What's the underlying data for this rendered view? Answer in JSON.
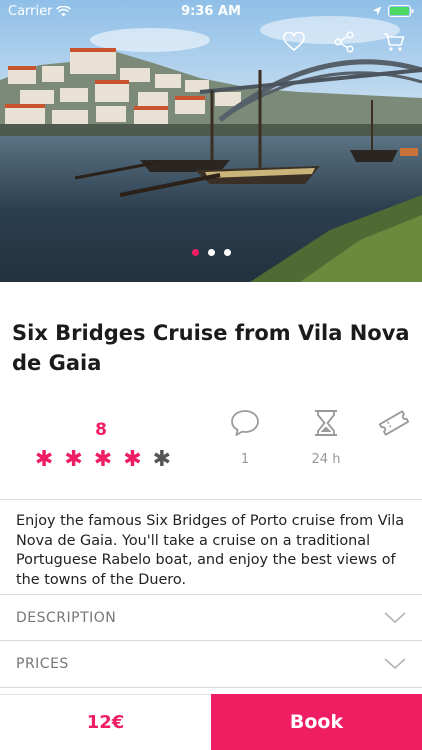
{
  "status_bar": {
    "carrier": "Carrier",
    "time": "9:36 AM"
  },
  "hero": {
    "image": "porto-river-boats-photo",
    "dots": 3,
    "active_dot": 0
  },
  "tour": {
    "title": "Six Bridges Cruise from Vila Nova de Gaia"
  },
  "stats": {
    "rating_score": "8",
    "rating_stars": 4,
    "rating_max": 5,
    "comments_count": "1",
    "duration": "24 h"
  },
  "description_text": "Enjoy the famous Six Bridges of Porto cruise from Vila Nova de Gaia. You'll take a cruise on a traditional Portuguese Rabelo boat, and enjoy the best views of the towns of the Duero.",
  "sections": {
    "description_label": "DESCRIPTION",
    "prices_label": "PRICES"
  },
  "footer": {
    "price": "12€",
    "book_label": "Book"
  },
  "colors": {
    "accent": "#ef1d62"
  }
}
